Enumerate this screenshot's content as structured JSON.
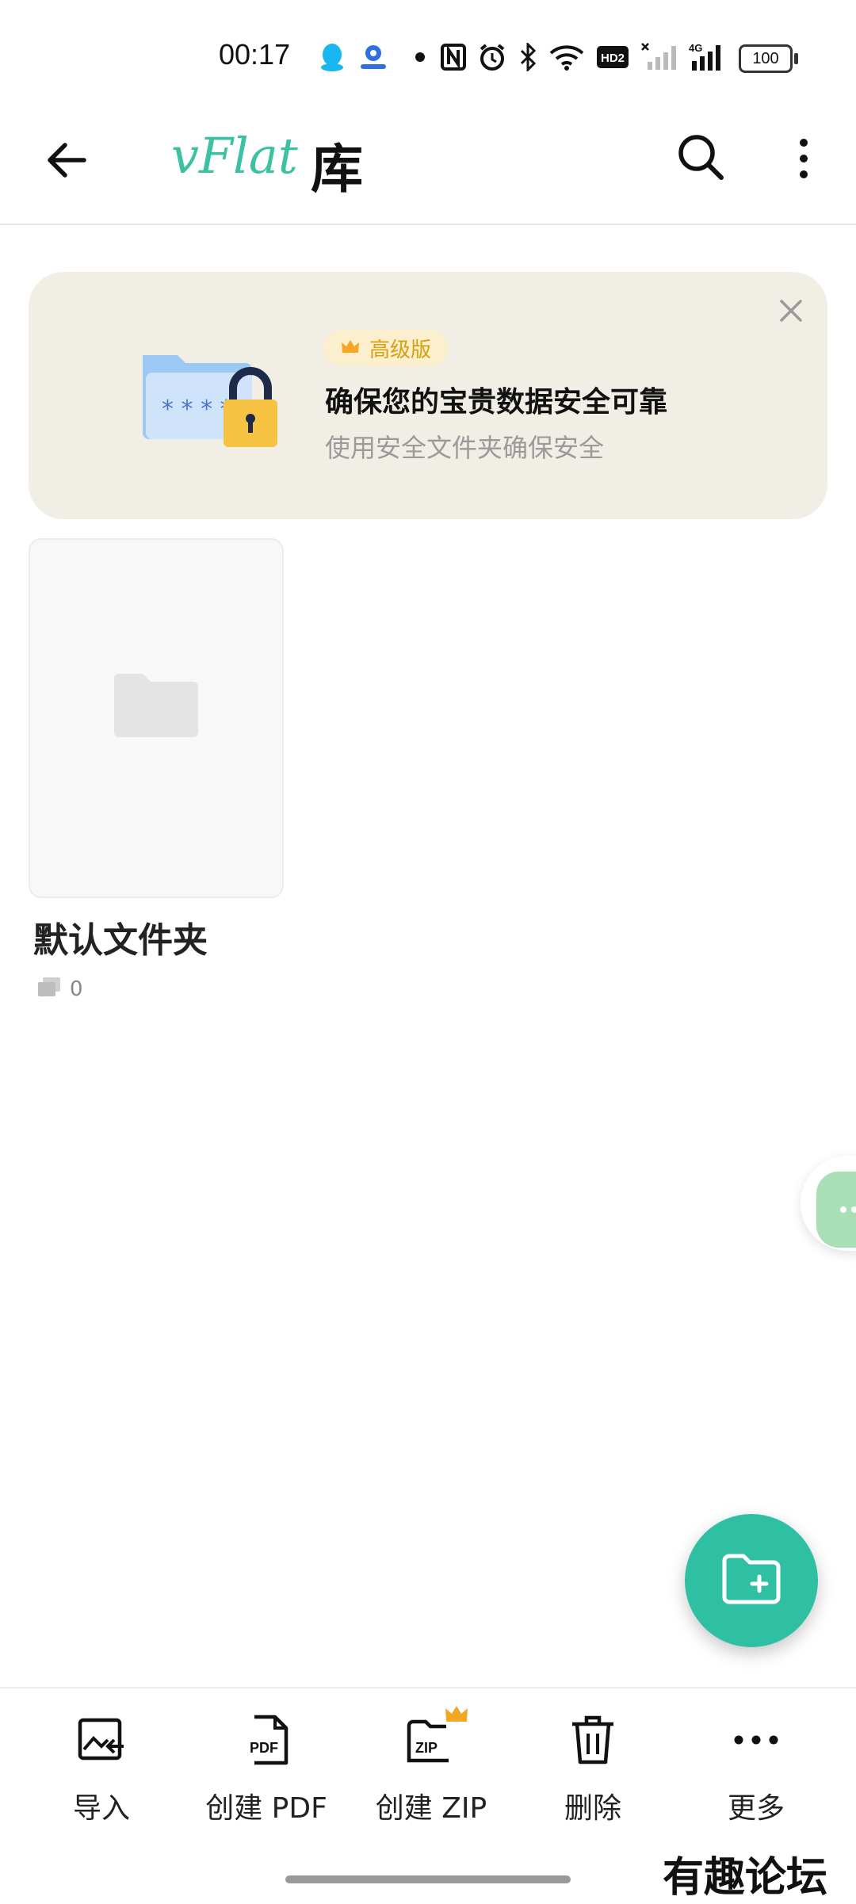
{
  "status_bar": {
    "time": "00:17",
    "battery": "100",
    "network": "4G",
    "hd": "HD2",
    "icons": [
      "qq-icon",
      "app-notification-icon",
      "dot-icon",
      "nfc-icon",
      "alarm-icon",
      "bluetooth-icon",
      "wifi-icon",
      "hd-icon",
      "signal-off-icon",
      "signal-4g-icon",
      "battery-icon"
    ]
  },
  "app_bar": {
    "brand": "vFlat",
    "title": "库"
  },
  "banner": {
    "badge": "高级版",
    "title": "确保您的宝贵数据安全可靠",
    "subtitle": "使用安全文件夹确保安全"
  },
  "folders": [
    {
      "name": "默认文件夹",
      "count": "0"
    }
  ],
  "toolbar": {
    "items": [
      {
        "label": "导入",
        "icon": "import-image-icon"
      },
      {
        "label": "创建 PDF",
        "icon": "pdf-file-icon"
      },
      {
        "label": "创建 ZIP",
        "icon": "zip-folder-icon"
      },
      {
        "label": "删除",
        "icon": "trash-icon"
      },
      {
        "label": "更多",
        "icon": "more-horizontal-icon"
      }
    ]
  },
  "watermark": "有趣论坛",
  "colors": {
    "accent": "#2fbfa2",
    "brand_text": "#3cc2a3",
    "banner_bg": "#f1efe5",
    "badge_text": "#d6a010"
  }
}
